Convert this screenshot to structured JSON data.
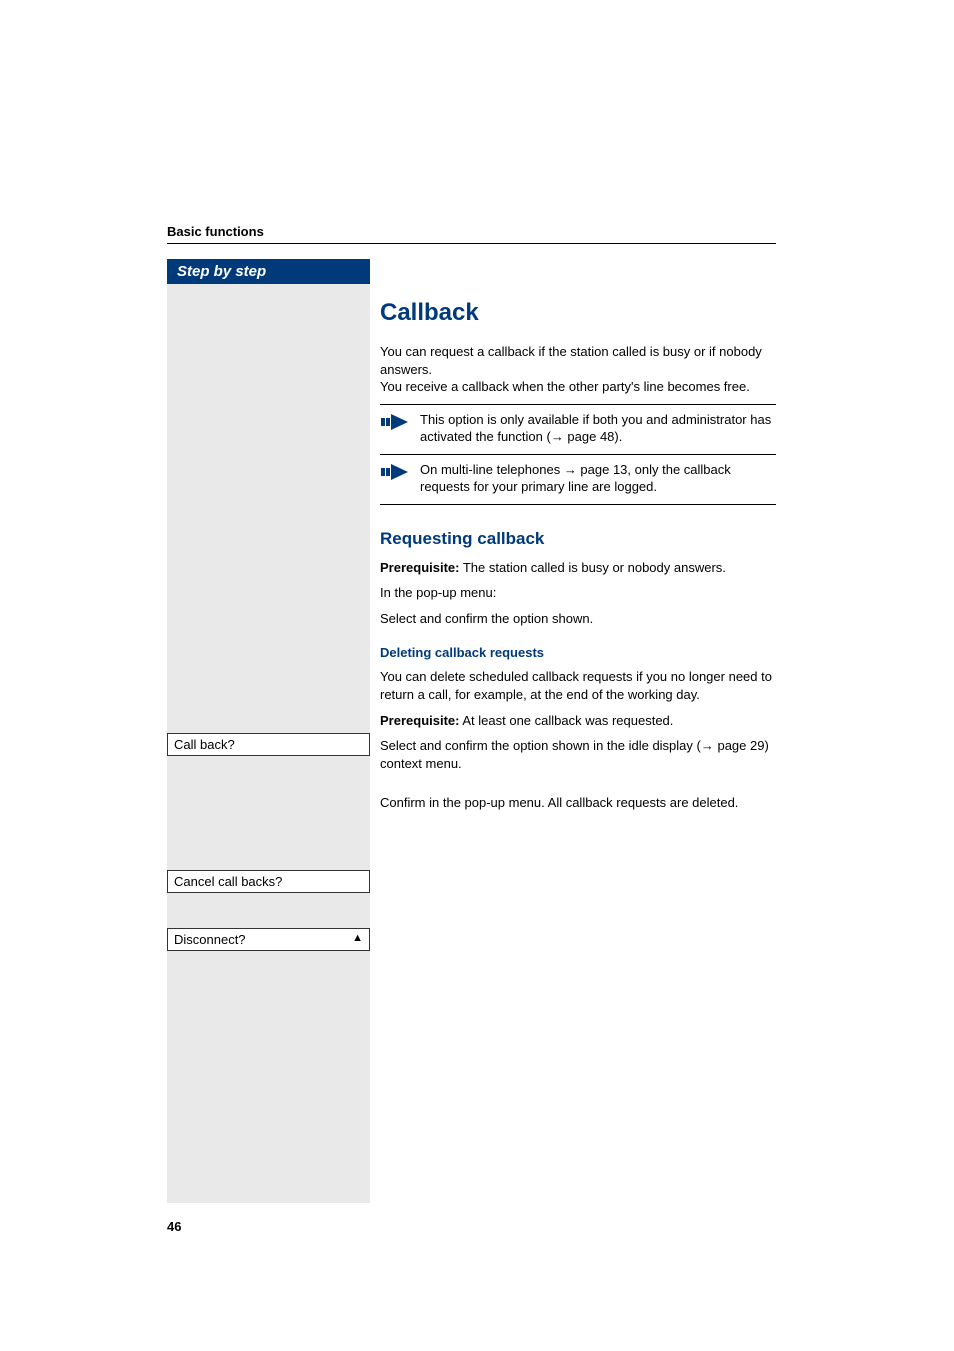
{
  "header": {
    "chapter": "Basic functions"
  },
  "sidebar": {
    "title": "Step by step"
  },
  "displays": {
    "callback": "Call back?",
    "cancel": "Cancel call backs?",
    "disconnect": "Disconnect?",
    "disconnect_arrow": "▲"
  },
  "content": {
    "h1": "Callback",
    "intro_line1": "You can request a callback if the station called is busy or if nobody answers.",
    "intro_line2": "You receive a callback when the other party's line becomes free.",
    "note1_part1": "This option is only available if both you and administrator has activated the function (",
    "note1_ref": "→ page 48",
    "note1_part2": ").",
    "note2_part1": "On multi-line telephones ",
    "note2_ref": "→ page 13",
    "note2_part2": ", only the callback requests for your primary line are logged.",
    "h2": "Requesting callback",
    "prereq_label": "Prerequisite:",
    "prereq1_text": " The station called is busy or nobody answers.",
    "popup_line": "In the pop-up menu:",
    "select_confirm": "Select and confirm the option shown.",
    "h3": "Deleting callback requests",
    "delete_para": "You can delete scheduled callback requests if you no longer need to return a call, for example, at the end of the working day.",
    "prereq2_text": " At least one callback was requested.",
    "select_idle_part1": "Select and confirm the option shown in the idle display (",
    "select_idle_ref": "→ page 29",
    "select_idle_part2": ") context menu.",
    "confirm_popup": "Confirm in the pop-up menu. All callback requests are deleted."
  },
  "footer": {
    "page_number": "46"
  }
}
